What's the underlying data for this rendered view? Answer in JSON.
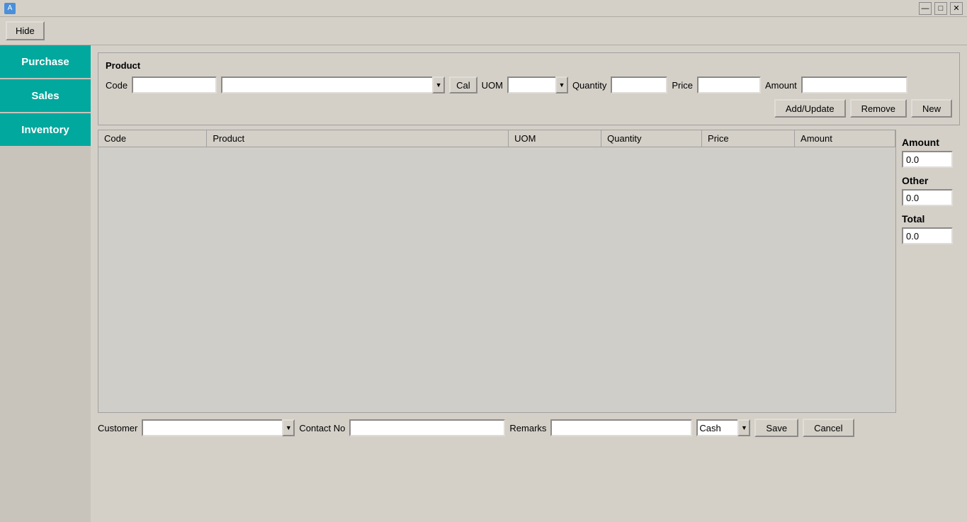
{
  "titlebar": {
    "icon": "A",
    "controls": {
      "minimize": "—",
      "maximize": "□",
      "close": "✕"
    }
  },
  "toolbar": {
    "hide_label": "Hide"
  },
  "sidebar": {
    "items": [
      {
        "id": "purchase",
        "label": "Purchase",
        "class": "purchase"
      },
      {
        "id": "sales",
        "label": "Sales",
        "class": "sales"
      },
      {
        "id": "inventory",
        "label": "Inventory",
        "class": "inventory"
      }
    ]
  },
  "product": {
    "section_label": "Product",
    "code_label": "Code",
    "code_value": "",
    "product_placeholder": "",
    "cal_label": "Cal",
    "uom_label": "UOM",
    "uom_value": "",
    "quantity_label": "Quantity",
    "quantity_value": "",
    "price_label": "Price",
    "price_value": "",
    "amount_label": "Amount",
    "amount_value": "",
    "add_update_label": "Add/Update",
    "remove_label": "Remove",
    "new_label": "New"
  },
  "table": {
    "columns": [
      "Code",
      "Product",
      "UOM",
      "Quantity",
      "Price",
      "Amount"
    ],
    "rows": []
  },
  "summary": {
    "amount_label": "Amount",
    "amount_value": "0.0",
    "other_label": "Other",
    "other_value": "0.0",
    "total_label": "Total",
    "total_value": "0.0"
  },
  "bottom": {
    "customer_label": "Customer",
    "customer_value": "",
    "contact_label": "Contact No",
    "contact_value": "",
    "remarks_label": "Remarks",
    "remarks_value": "",
    "cash_label": "Cash",
    "save_label": "Save",
    "cancel_label": "Cancel"
  },
  "dropdown_arrow": "▼"
}
